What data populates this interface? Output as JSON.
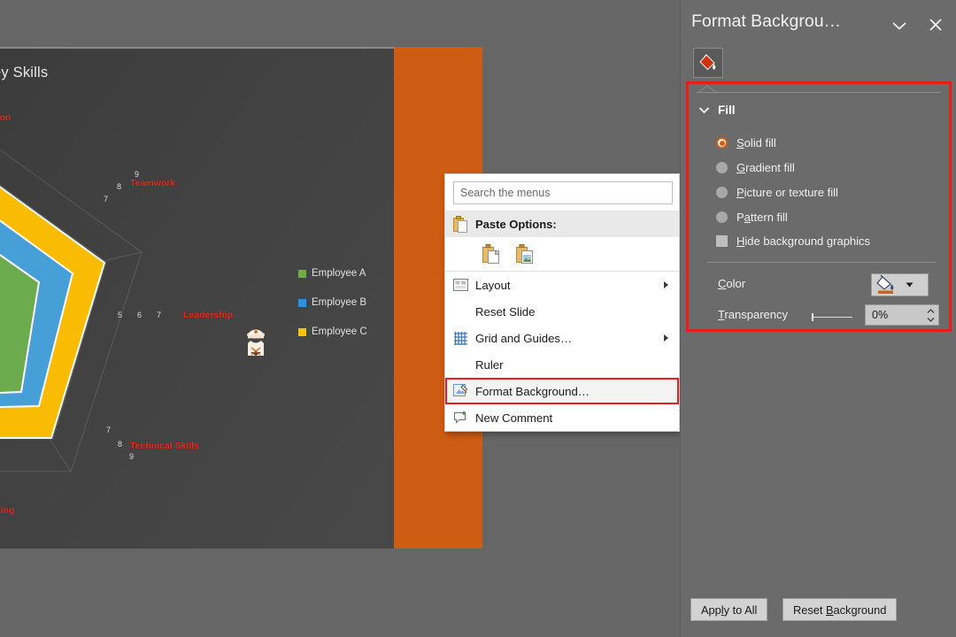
{
  "pane": {
    "title": "Format Backgrou…",
    "caret_icon": "chevron-down-icon",
    "close_icon": "close-icon",
    "tab_icon": "fill-bucket-icon",
    "fill_section_label": "Fill",
    "fill_collapse_icon": "chevron-down-icon",
    "fill_options": [
      {
        "label": "Solid fill",
        "accesskey": "S",
        "selected": true
      },
      {
        "label": "Gradient fill",
        "accesskey": "G",
        "selected": false
      },
      {
        "label": "Picture or texture fill",
        "accesskey": "P",
        "selected": false
      },
      {
        "label": "Pattern fill",
        "accesskey": "a",
        "selected": false
      }
    ],
    "hide_background_graphics": {
      "label": "Hide background graphics",
      "accesskey": "H",
      "checked": false
    },
    "color_label": "Color",
    "color_accesskey": "C",
    "color_swatch_hex": "#d4610f",
    "transparency_label": "Transparency",
    "transparency_accesskey": "T",
    "transparency_value": "0%",
    "apply_to_all_label": "Apply to All",
    "reset_background_label": "Reset Background",
    "highlight_color": "#ea1c1c"
  },
  "context_menu": {
    "search_placeholder": "Search the menus",
    "search_value": "",
    "paste_options_label": "Paste Options:",
    "paste_icons": [
      "paste-keep-formatting-icon",
      "paste-picture-icon"
    ],
    "items": [
      {
        "label": "Layout",
        "accesskey": "L",
        "icon": "layout-icon",
        "submenu": true,
        "highlighted": false
      },
      {
        "label": "Reset Slide",
        "accesskey": "R",
        "icon": "",
        "submenu": false,
        "highlighted": false
      },
      {
        "label": "Grid and Guides…",
        "accesskey": "i",
        "icon": "grid-icon",
        "submenu": true,
        "highlighted": false
      },
      {
        "label": "Ruler",
        "accesskey": "R",
        "icon": "",
        "submenu": false,
        "highlighted": false
      },
      {
        "label": "Format Background…",
        "accesskey": "B",
        "icon": "format-background-icon",
        "submenu": false,
        "highlighted": true
      },
      {
        "label": "New Comment",
        "accesskey": "",
        "icon": "new-comment-icon",
        "submenu": false,
        "highlighted": false
      }
    ]
  },
  "slide": {
    "background_hex": "#3f3f3f",
    "accent_band_hex": "#cf5c13",
    "avatar_icon": "officer-avatar-icon"
  },
  "chart_data": {
    "type": "radar",
    "title": "…omparison Across Key Skills",
    "categories": [
      "Communication",
      "Teamwork",
      "Leadership",
      "Technical Skills",
      "Problem Solving"
    ],
    "visible_category_labels": [
      "…ication",
      "Teamwork",
      "Leadership",
      "Technical Skills",
      "…Solving"
    ],
    "series": [
      {
        "name": "Employee A",
        "color": "#70ad47",
        "values": [
          7,
          6,
          5,
          8,
          7
        ]
      },
      {
        "name": "Employee B",
        "color": "#3f9de0",
        "values": [
          8,
          7,
          6,
          7,
          8
        ]
      },
      {
        "name": "Employee C",
        "color": "#ffc000",
        "values": [
          9,
          8,
          7,
          9,
          8
        ]
      }
    ],
    "tick_labels_by_axis": {
      "Teamwork": [
        "7",
        "8",
        "9"
      ],
      "Leadership": [
        "5",
        "6",
        "7"
      ],
      "Technical Skills": [
        "7",
        "8",
        "9"
      ]
    },
    "legend_position": "right",
    "legend_entries": [
      "Employee A",
      "Employee B",
      "Employee C"
    ],
    "grid": true,
    "rlim": [
      0,
      10
    ]
  }
}
